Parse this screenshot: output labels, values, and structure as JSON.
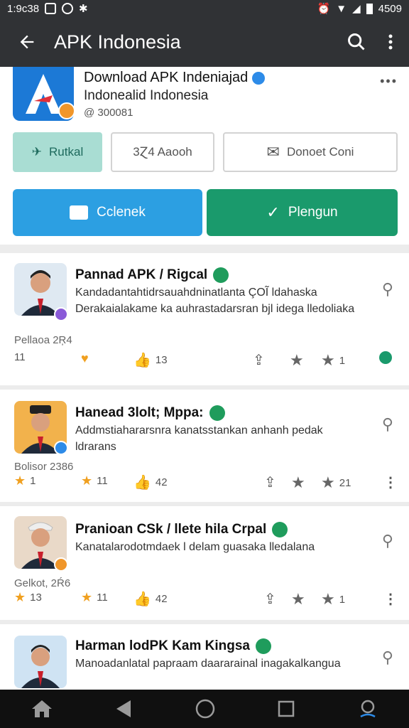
{
  "status_bar": {
    "time": "1:9c38",
    "battery": "4509"
  },
  "app_bar": {
    "title": "APK Indonesia"
  },
  "header": {
    "app_name": "Download APK Indeniajad",
    "app_subtitle": "Indonealid Indonesia",
    "app_id": "@ 300081",
    "chips": {
      "chip1": "Rutkal",
      "chip2": "3Ɀ4  Aaooh",
      "chip3": "Donoet Coni"
    },
    "buttons": {
      "primary": "Cclenek",
      "secondary": "Plengun"
    },
    "colors": {
      "primary_blue": "#2c9fe2",
      "primary_green": "#1a9a6c",
      "chip_teal": "#a9ddd3"
    }
  },
  "posts": [
    {
      "title": "Pannad APK / Rigcal",
      "text": "Kandadantahtidrsauahdninatlanta ÇOĨ ldahaska Derakaialakame ka auhrastadarsran bjl idega lledoliaka",
      "meta": "Pellaoa 2Ŗ4",
      "stats": [
        "11",
        "13",
        "1"
      ]
    },
    {
      "title": "Hanead 3lolt; Mppa:",
      "text": "Addmstiahararsnra kanatsstankan anhanh pedak ldrarans",
      "meta": "Bolisor 2386",
      "stats": [
        "1",
        "11",
        "42",
        "21"
      ]
    },
    {
      "title": "Pranioan CSk / llete hila Crpal",
      "text": "Kanatalarodotmdaek l delam guasaka lledalana",
      "meta": "Gelkot, 2Ŕ6",
      "stats": [
        "13",
        "11",
        "42",
        "1"
      ]
    },
    {
      "title": "Harman lodPK Kam Kingsa",
      "text": "Manoadanlatal papraam daararainal inagakalkangua"
    }
  ]
}
